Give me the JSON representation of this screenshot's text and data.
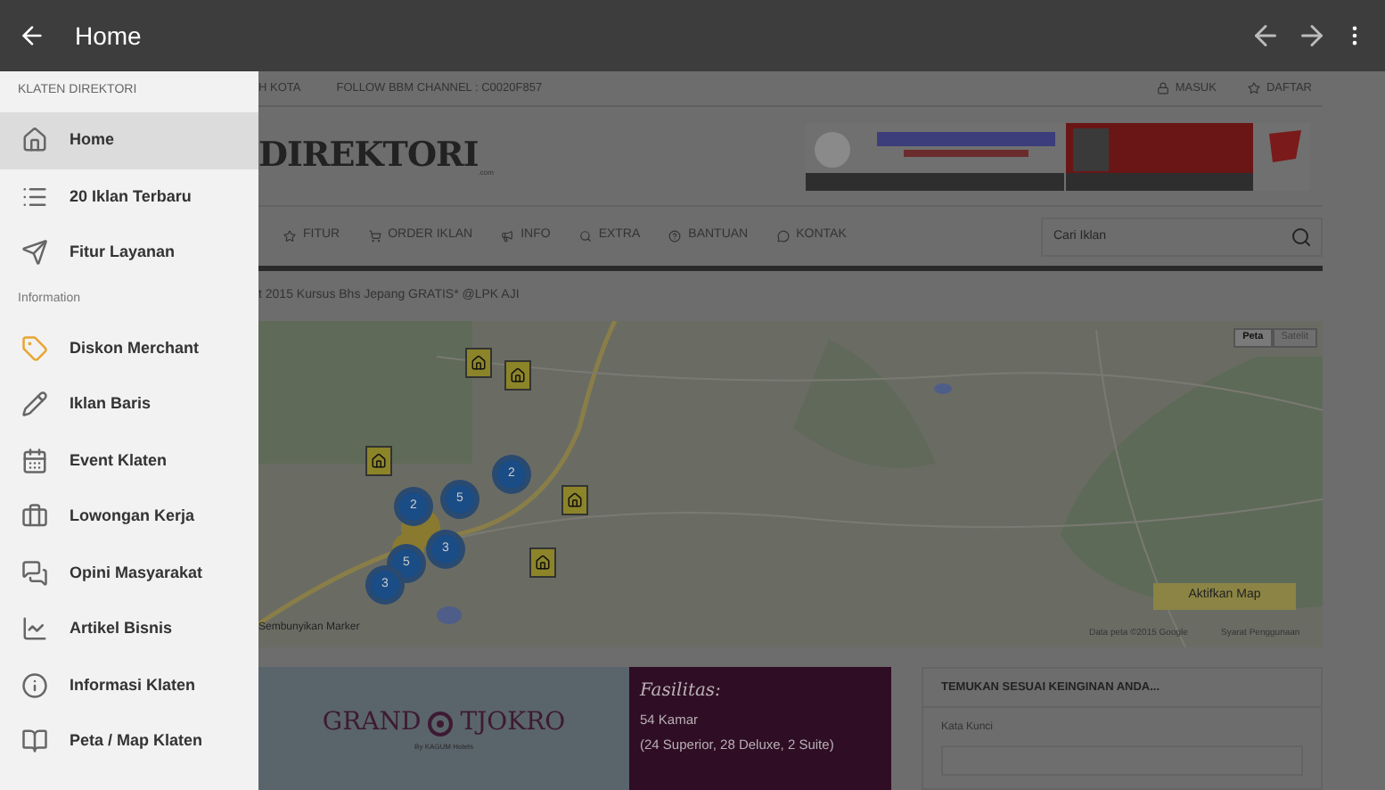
{
  "app_bar": {
    "title": "Home"
  },
  "drawer": {
    "header": "KLATEN DIREKTORI",
    "items": [
      {
        "label": "Home",
        "selected": true
      },
      {
        "label": "20 Iklan Terbaru",
        "selected": false
      },
      {
        "label": "Fitur Layanan",
        "selected": false
      }
    ],
    "section": "Information",
    "info_items": [
      {
        "label": "Diskon Merchant",
        "selected": false
      },
      {
        "label": "Iklan Baris",
        "selected": false
      },
      {
        "label": "Event Klaten",
        "selected": false
      },
      {
        "label": "Lowongan Kerja",
        "selected": false
      },
      {
        "label": "Opini Masyarakat",
        "selected": false
      },
      {
        "label": "Artikel Bisnis",
        "selected": false
      },
      {
        "label": "Informasi Klaten",
        "selected": false
      },
      {
        "label": "Peta / Map Klaten",
        "selected": false
      }
    ]
  },
  "page": {
    "top_links": [
      "H KOTA",
      "FOLLOW BBM CHANNEL : C0020F857"
    ],
    "account_links": [
      "MASUK",
      "DAFTAR"
    ],
    "logo": "DIREKTORI",
    "logo_suffix": ".com",
    "nav": [
      "FITUR",
      "ORDER IKLAN",
      "INFO",
      "EXTRA",
      "BANTUAN",
      "KONTAK"
    ],
    "search": {
      "placeholder": "Cari Iklan"
    },
    "ticker": "t 2015 Kursus Bhs Jepang GRATIS* @LPK AJI",
    "map": {
      "map_types": [
        {
          "label": "Peta",
          "selected": true
        },
        {
          "label": "Satelit",
          "selected": false
        }
      ],
      "clusters": [
        "2",
        "2",
        "5",
        "3",
        "5",
        "3"
      ],
      "activate_button": "Aktifkan Map",
      "hide_markers": "Sembunyikan Marker",
      "attribution": "Data peta ©2015 Google",
      "terms": "Syarat Penggunaan"
    },
    "ad": {
      "brand_left": "GRAND",
      "brand_right": "TJOKRO",
      "brand_sub": "By KAGUM Hotels",
      "heading": "Fasilitas:",
      "line_1": "54 Kamar",
      "line_2": "(24 Superior, 28 Deluxe, 2 Suite)"
    },
    "finder": {
      "title": "TEMUKAN SESUAI KEINGINAN ANDA...",
      "label": "Kata Kunci"
    }
  }
}
